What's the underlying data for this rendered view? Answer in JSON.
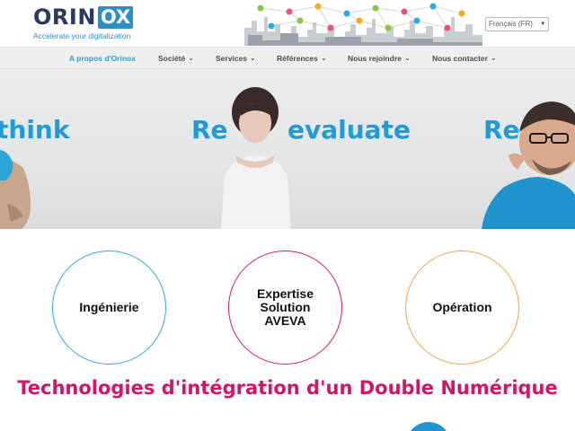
{
  "header": {
    "logo_word_left": "ORIN",
    "logo_word_right": "OX",
    "logo_tagline": "Accelerate your digitalization",
    "language": "Français (FR)"
  },
  "nav": {
    "items": [
      {
        "label": "A propos d'Orinox",
        "dropdown": false,
        "active": true
      },
      {
        "label": "Société",
        "dropdown": true,
        "active": false
      },
      {
        "label": "Services",
        "dropdown": true,
        "active": false
      },
      {
        "label": "Références",
        "dropdown": true,
        "active": false
      },
      {
        "label": "Nous rejoindre",
        "dropdown": true,
        "active": false
      },
      {
        "label": "Nous contacter",
        "dropdown": true,
        "active": false
      }
    ],
    "chevron": "⌄"
  },
  "hero": {
    "words": [
      "think",
      "Re",
      "evaluate",
      "Re"
    ]
  },
  "services": [
    {
      "label": "Ingénierie",
      "color": "#31a8db"
    },
    {
      "label": "Expertise\nSolution\nAVEVA",
      "color": "#d81b72"
    },
    {
      "label": "Opération",
      "color": "#f0a44a"
    }
  ],
  "section_title": "Technologies d'intégration d'un Double Numérique",
  "colors": {
    "brand_blue": "#2a8fc9",
    "brand_navy": "#2a3a5c",
    "accent_pink": "#d0166b",
    "hero_blue": "#1f9bd8"
  }
}
